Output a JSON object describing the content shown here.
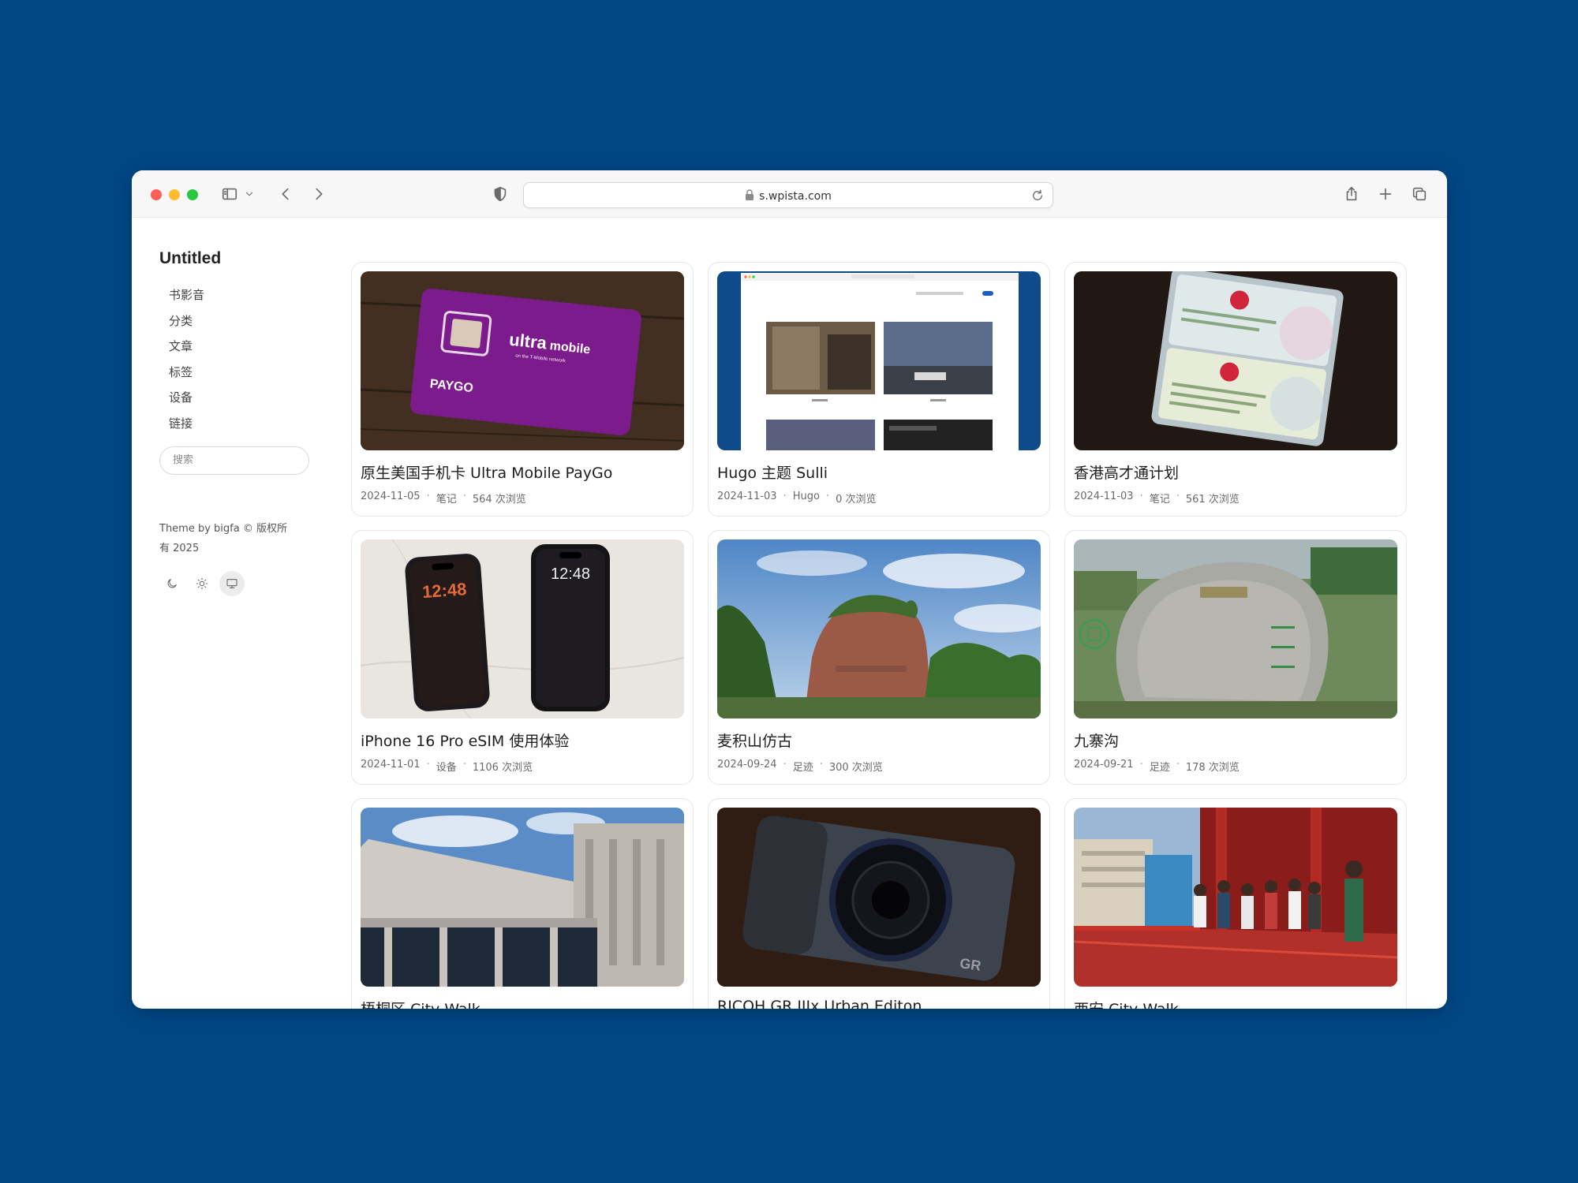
{
  "browser": {
    "url": "s.wpista.com",
    "icons": [
      "close-dot",
      "minimize-dot",
      "zoom-dot",
      "sidebar-icon",
      "chevron-down-icon",
      "back-icon",
      "forward-icon",
      "shield-icon",
      "lock-icon",
      "reload-icon",
      "share-icon",
      "new-tab-icon",
      "tabs-overview-icon"
    ]
  },
  "sidebar": {
    "title": "Untitled",
    "nav": [
      {
        "label": "书影音"
      },
      {
        "label": "分类"
      },
      {
        "label": "文章"
      },
      {
        "label": "标签"
      },
      {
        "label": "设备"
      },
      {
        "label": "链接"
      }
    ],
    "search_placeholder": "搜索",
    "credit": "Theme by bigfa © 版权所有 2025",
    "theme_icons": [
      "moon-icon",
      "sun-icon",
      "monitor-icon"
    ],
    "active_theme": "monitor-icon"
  },
  "posts": [
    {
      "title": "原生美国手机卡 Ultra Mobile PayGo",
      "date": "2024-11-05",
      "category": "笔记",
      "views": "564 次浏览",
      "thumb_texts": [
        "ultra",
        "mobile",
        "on the T-Mobile network",
        "PAYGO"
      ]
    },
    {
      "title": "Hugo 主题 Sulli",
      "date": "2024-11-03",
      "category": "Hugo",
      "views": "0 次浏览"
    },
    {
      "title": "香港高才通计划",
      "date": "2024-11-03",
      "category": "笔记",
      "views": "561 次浏览"
    },
    {
      "title": "iPhone 16 Pro eSIM 使用体验",
      "date": "2024-11-01",
      "category": "设备",
      "views": "1106 次浏览",
      "thumb_texts": [
        "12:48",
        "12:48"
      ]
    },
    {
      "title": "麦积山仿古",
      "date": "2024-09-24",
      "category": "足迹",
      "views": "300 次浏览"
    },
    {
      "title": "九寨沟",
      "date": "2024-09-21",
      "category": "足迹",
      "views": "178 次浏览"
    },
    {
      "title": "梧桐区 City Walk",
      "date": "",
      "category": "",
      "views": ""
    },
    {
      "title": "RICOH GR IIIx Urban Editon",
      "date": "",
      "category": "",
      "views": "",
      "thumb_texts": [
        "GR"
      ]
    },
    {
      "title": "西安 City Walk",
      "date": "",
      "category": "",
      "views": ""
    }
  ],
  "colors": {
    "page_background": "#014785",
    "window_background": "#ffffff"
  }
}
